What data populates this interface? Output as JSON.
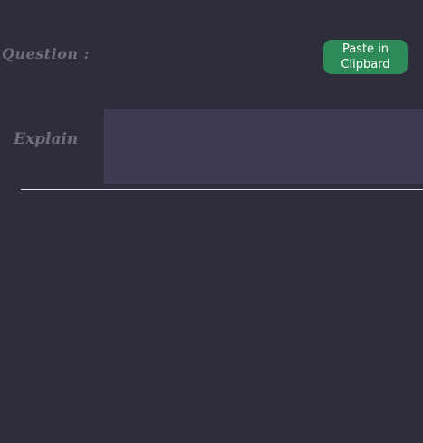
{
  "question": {
    "label": "Question :"
  },
  "paste_button": {
    "label_line1": "Paste in",
    "label_line2": "Clipbard"
  },
  "explain": {
    "label": "Explain",
    "value": ""
  },
  "colors": {
    "background": "#2d2d3c",
    "label_text": "#6e6e7c",
    "button": "#2e8b57",
    "field": "#3e3c52",
    "divider": "#e6e6ea"
  }
}
